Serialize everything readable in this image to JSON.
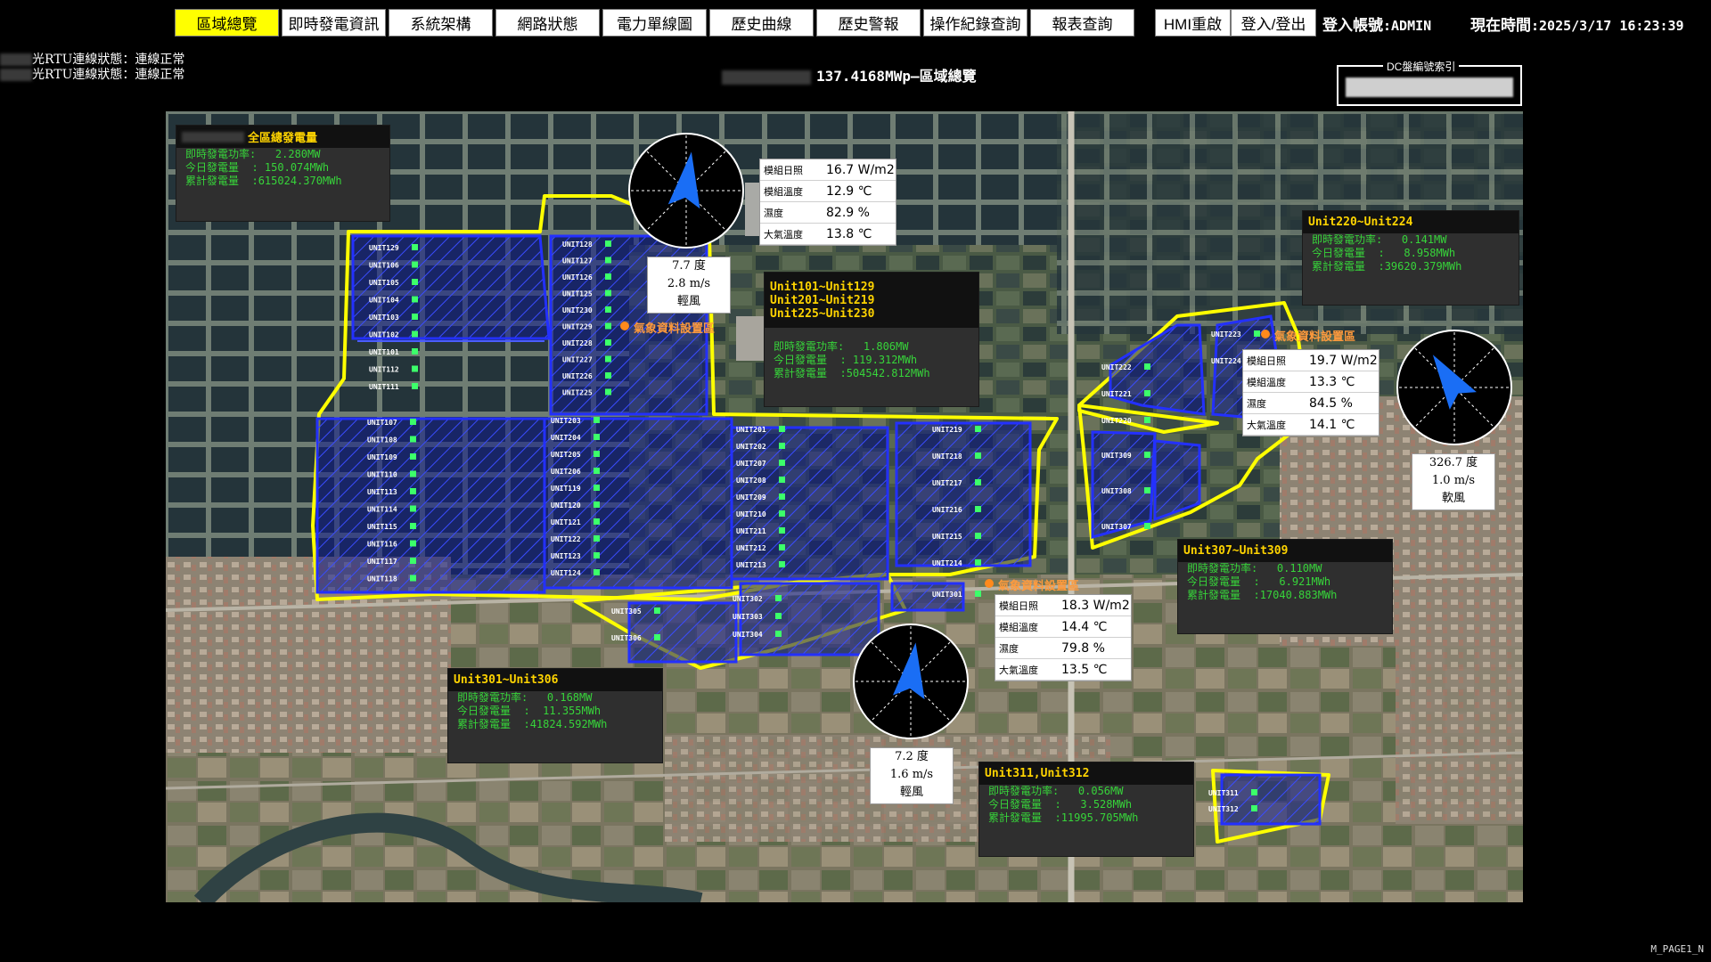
{
  "nav": {
    "tabs": [
      "區域總覽",
      "即時發電資訊",
      "系統架構",
      "網路狀態",
      "電力單線圖",
      "歷史曲線",
      "歷史警報",
      "操作紀錄查詢",
      "報表查詢"
    ],
    "active_index": 0,
    "hmi_reset": "HMI重啟",
    "login_logout": "登入/登出"
  },
  "header": {
    "account_label": "登入帳號",
    "account_value": ":ADMIN",
    "time_label": "現在時間",
    "time_value": ":2025/3/17  16:23:39"
  },
  "rtu_status": [
    {
      "label": "光RTU連線狀態：",
      "value": "連線正常"
    },
    {
      "label": "光RTU連線狀態：",
      "value": "連線正常"
    }
  ],
  "title": {
    "capacity": "137.4168MWp",
    "sep": "—",
    "name": "區域總覽"
  },
  "dc_index": {
    "label": "DC盤編號索引"
  },
  "total_panel": {
    "title": "全區總發電量",
    "rows": [
      {
        "label": "即時發電功率:",
        "value": "   2.280MW"
      },
      {
        "label": "今日發電量",
        "value": "  : 150.074MWh"
      },
      {
        "label": "累計發電量",
        "value": "  :615024.370MWh"
      }
    ]
  },
  "groups": [
    {
      "id": "g1",
      "name_lines": [
        "Unit101~Unit129",
        "Unit201~Unit219",
        "Unit225~Unit230"
      ],
      "power": "   1.806MW",
      "today": "  : 119.312MWh",
      "total": "  :504542.812MWh"
    },
    {
      "id": "g2",
      "name_lines": [
        "Unit220~Unit224"
      ],
      "power": "   0.141MW",
      "today": "  :   8.958MWh",
      "total": "  :39620.379MWh"
    },
    {
      "id": "g3",
      "name_lines": [
        "Unit307~Unit309"
      ],
      "power": "   0.110MW",
      "today": "  :   6.921MWh",
      "total": "  :17040.883MWh"
    },
    {
      "id": "g4",
      "name_lines": [
        "Unit301~Unit306"
      ],
      "power": "   0.168MW",
      "today": "  :  11.355MWh",
      "total": "  :41824.592MWh"
    },
    {
      "id": "g5",
      "name_lines": [
        "Unit311,Unit312"
      ],
      "power": "   0.056MW",
      "today": "  :   3.528MWh",
      "total": "  :11995.705MWh"
    }
  ],
  "group_labels": {
    "power": "即時發電功率:",
    "today": "今日發電量",
    "total": "累計發電量"
  },
  "weather_labels": {
    "irr": "模組日照",
    "mod_temp": "模組溫度",
    "humidity": "濕度",
    "air_temp": "大氣溫度"
  },
  "weather": [
    {
      "id": "w1",
      "irr": "16.7 W/m2",
      "mod_temp": "12.9 ℃",
      "humidity": "82.9 %",
      "air_temp": "13.8 ℃"
    },
    {
      "id": "w2",
      "irr": "19.7 W/m2",
      "mod_temp": "13.3 ℃",
      "humidity": "84.5 %",
      "air_temp": "14.1 ℃"
    },
    {
      "id": "w3",
      "irr": "18.3 W/m2",
      "mod_temp": "14.4 ℃",
      "humidity": "79.8 %",
      "air_temp": "13.5 ℃"
    }
  ],
  "wind": [
    {
      "id": "c1",
      "deg": "7.7 度",
      "speed": "2.8 m/s",
      "desc": "輕風",
      "heading": 7.7
    },
    {
      "id": "c2",
      "deg": "326.7 度",
      "speed": "1.0 m/s",
      "desc": "軟風",
      "heading": 326.7
    },
    {
      "id": "c3",
      "deg": "7.2 度",
      "speed": "1.6 m/s",
      "desc": "輕風",
      "heading": 7.2
    }
  ],
  "sensor_label": "氣象資料設置區",
  "units": {
    "col_a": [
      "UNIT129",
      "UNIT106",
      "UNIT105",
      "UNIT104",
      "UNIT103",
      "UNIT102",
      "UNIT101",
      "UNIT112",
      "UNIT111"
    ],
    "col_b": [
      "UNIT128",
      "UNIT127",
      "UNIT126",
      "UNIT125",
      "UNIT230",
      "UNIT229",
      "UNIT228",
      "UNIT227",
      "UNIT226",
      "UNIT225"
    ],
    "col_c": [
      "UNIT107",
      "UNIT108",
      "UNIT109",
      "UNIT110",
      "UNIT113",
      "UNIT114",
      "UNIT115",
      "UNIT116",
      "UNIT117",
      "UNIT118"
    ],
    "col_d": [
      "UNIT203",
      "UNIT204",
      "UNIT205",
      "UNIT206",
      "UNIT119",
      "UNIT120",
      "UNIT121",
      "UNIT122",
      "UNIT123",
      "UNIT124"
    ],
    "col_e": [
      "UNIT201",
      "UNIT202",
      "UNIT207",
      "UNIT208",
      "UNIT209",
      "UNIT210",
      "UNIT211",
      "UNIT212",
      "UNIT213"
    ],
    "col_f": [
      "UNIT219",
      "UNIT218",
      "UNIT217",
      "UNIT216",
      "UNIT215",
      "UNIT214"
    ],
    "col_g": [
      "UNIT223",
      "UNIT224"
    ],
    "col_h": [
      "UNIT222",
      "UNIT221",
      "UNIT220"
    ],
    "col_i": [
      "UNIT309",
      "UNIT308",
      "UNIT307"
    ],
    "col_j": [
      "UNIT305",
      "UNIT306"
    ],
    "col_k": [
      "UNIT302",
      "UNIT303",
      "UNIT304"
    ],
    "col_l": [
      "UNIT301"
    ],
    "col_m": [
      "UNIT311",
      "UNIT312"
    ]
  },
  "page_id": "M_PAGE1_N"
}
